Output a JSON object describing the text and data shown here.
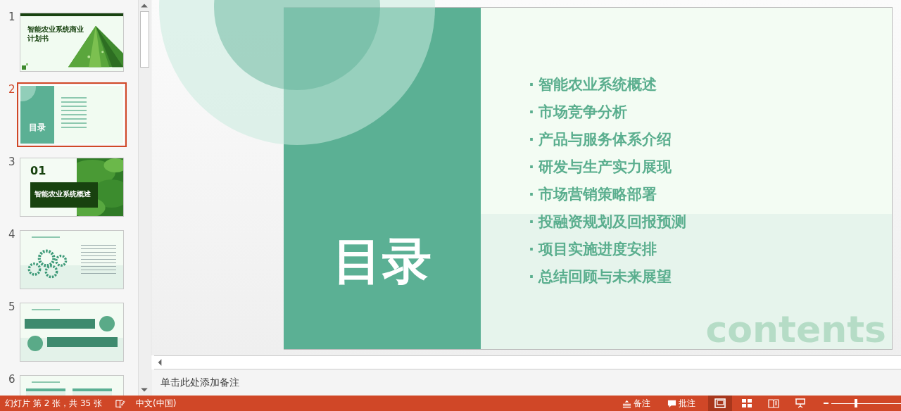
{
  "thumbnails": [
    {
      "number": "1",
      "selected": false,
      "kind": "title",
      "texts": [
        "智能农业系统商业计划书"
      ]
    },
    {
      "number": "2",
      "selected": true,
      "kind": "toc",
      "texts": [
        "目录"
      ]
    },
    {
      "number": "3",
      "selected": false,
      "kind": "section",
      "texts": [
        "01",
        "智能农业系统概述"
      ]
    },
    {
      "number": "4",
      "selected": false,
      "kind": "gears"
    },
    {
      "number": "5",
      "selected": false,
      "kind": "boxes"
    },
    {
      "number": "6",
      "selected": false,
      "kind": "table"
    }
  ],
  "slide": {
    "title": "目录",
    "items": [
      {
        "bullet": "·",
        "text": "智能农业系统概述"
      },
      {
        "bullet": "·",
        "text": "市场竞争分析"
      },
      {
        "bullet": "·",
        "text": "产品与服务体系介绍"
      },
      {
        "bullet": "·",
        "text": "研发与生产实力展现"
      },
      {
        "bullet": "·",
        "text": "市场营销策略部署"
      },
      {
        "bullet": "·",
        "text": "投融资规划及回报预测"
      },
      {
        "bullet": "·",
        "text": "项目实施进度安排"
      },
      {
        "bullet": "·",
        "text": "总结回顾与未来展望"
      }
    ],
    "background_word": "contents"
  },
  "notes": {
    "placeholder": "单击此处添加备注"
  },
  "status_bar": {
    "slide_info": "幻灯片 第 2 张，共 35 张",
    "language": "中文(中国)",
    "notes_button": "备注",
    "comments_button": "批注",
    "views": [
      {
        "kind": "normal",
        "selected": true
      },
      {
        "kind": "sorter",
        "selected": false
      },
      {
        "kind": "reading",
        "selected": false
      },
      {
        "kind": "show",
        "selected": false
      }
    ],
    "zoom": {
      "level": 0.33
    }
  }
}
